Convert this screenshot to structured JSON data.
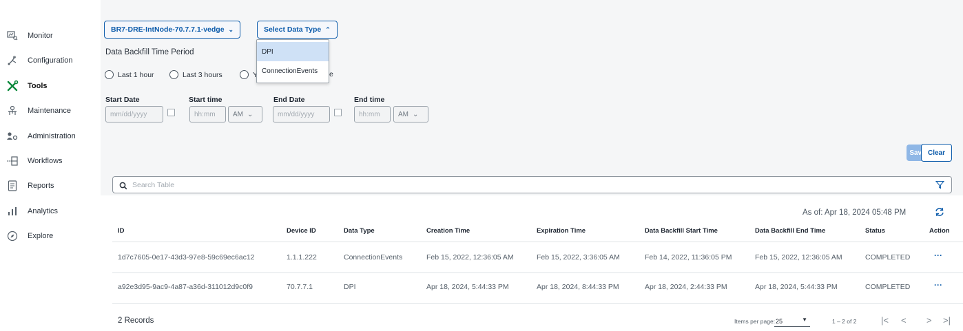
{
  "sidebar": {
    "items": [
      {
        "label": "Monitor",
        "icon": "monitor-icon"
      },
      {
        "label": "Configuration",
        "icon": "configuration-icon"
      },
      {
        "label": "Tools",
        "icon": "tools-icon",
        "active": true
      },
      {
        "label": "Maintenance",
        "icon": "maintenance-icon"
      },
      {
        "label": "Administration",
        "icon": "administration-icon"
      },
      {
        "label": "Workflows",
        "icon": "workflows-icon"
      },
      {
        "label": "Reports",
        "icon": "reports-icon"
      },
      {
        "label": "Analytics",
        "icon": "analytics-icon"
      },
      {
        "label": "Explore",
        "icon": "explore-icon"
      }
    ]
  },
  "form": {
    "device_select": "BR7-DRE-IntNode-70.7.7.1-vedge",
    "data_type_select": "Select Data Type",
    "data_type_options": [
      "DPI",
      "ConnectionEvents"
    ],
    "period_title": "Data Backfill Time Period",
    "radio_options": [
      "Last 1 hour",
      "Last 3 hours",
      "Y",
      "e"
    ],
    "start_date_label": "Start Date",
    "start_time_label": "Start time",
    "end_date_label": "End Date",
    "end_time_label": "End time",
    "date_placeholder": "mm/dd/yyyy",
    "time_placeholder": "hh:mm",
    "ampm_value": "AM",
    "save_label": "Save",
    "clear_label": "Clear"
  },
  "table": {
    "search_placeholder": "Search Table",
    "as_of": "As of: Apr 18, 2024 05:48 PM",
    "columns": [
      "ID",
      "Device ID",
      "Data Type",
      "Creation Time",
      "Expiration Time",
      "Data Backfill Start Time",
      "Data Backfill End Time",
      "Status",
      "Action"
    ],
    "rows": [
      [
        "1d7c7605-0e17-43d3-97e8-59c69ec6ac12",
        "1.1.1.222",
        "ConnectionEvents",
        "Feb 15, 2022, 12:36:05 AM",
        "Feb 15, 2022, 3:36:05 AM",
        "Feb 14, 2022, 11:36:05 PM",
        "Feb 15, 2022, 12:36:05 AM",
        "COMPLETED",
        "···"
      ],
      [
        "a92e3d95-9ac9-4a87-a36d-311012d9c0f9",
        "70.7.7.1",
        "DPI",
        "Apr 18, 2024, 5:44:33 PM",
        "Apr 18, 2024, 8:44:33 PM",
        "Apr 18, 2024, 2:44:33 PM",
        "Apr 18, 2024, 5:44:33 PM",
        "COMPLETED",
        "···"
      ]
    ],
    "records": "2 Records",
    "items_per_page_label": "Items per page:",
    "items_per_page": "25",
    "range": "1 – 2 of 2",
    "pager": {
      "first": "|<",
      "prev": "<",
      "next": ">",
      "last": ">|"
    }
  },
  "colors": {
    "accent": "#0d5cab",
    "band": "#f5f6f7",
    "highlight": "#cfe1f6"
  }
}
